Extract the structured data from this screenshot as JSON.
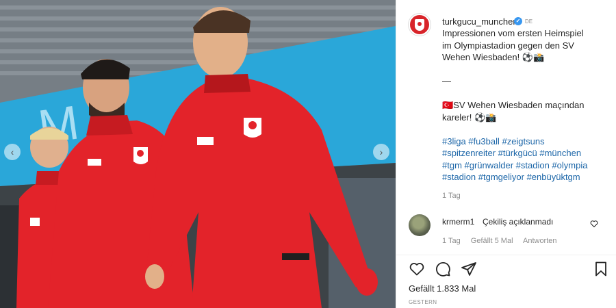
{
  "post": {
    "username": "turkgucu_munchen",
    "language_badge": "DE",
    "caption_de": [
      "Impressionen vom ersten Heimspiel",
      "im Olympiastadion gegen den SV",
      "Wehen Wiesbaden! ⚽📸"
    ],
    "separator": "—",
    "caption_tr": [
      "🇹🇷SV Wehen Wiesbaden maçından",
      "kareler! ⚽📸"
    ],
    "hashtags": [
      "#3liga #fu3ball #zeigtsuns",
      "#spitzenreiter #türkgücü #münchen",
      "#tgm #grünwalder #stadion #olympia",
      "#stadion #tgmgeliyor #enbüyüktgm"
    ],
    "time": "1 Tag"
  },
  "comment": {
    "username": "krmerm1",
    "text": "Çekiliş açıklanmadı",
    "time": "1 Tag",
    "likes": "Gefällt 5 Mal",
    "reply": "Antworten"
  },
  "footer": {
    "likes": "Gefällt 1.833 Mal",
    "posted": "GESTERN"
  },
  "photo": {
    "stadium_banner_text": "M    n",
    "nav_left": "‹",
    "nav_right": "›"
  },
  "colors": {
    "jersey_red": "#e3232a",
    "banner_blue": "#2aa7d9",
    "link": "#1c66a8",
    "muted": "#8e8e8e"
  },
  "icons": [
    "verified-badge-icon",
    "heart-icon",
    "comment-icon",
    "share-icon",
    "bookmark-icon",
    "chevron-left-icon",
    "chevron-right-icon"
  ]
}
